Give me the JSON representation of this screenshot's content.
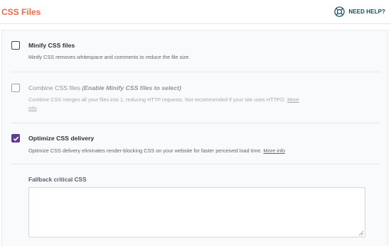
{
  "header": {
    "title": "CSS Files",
    "help_label": "NEED HELP?",
    "help_icon": "lifebuoy-icon"
  },
  "options": [
    {
      "label": "Minify CSS files",
      "note": "",
      "description": "Minify CSS removes whitespace and comments to reduce the file size.",
      "link": "",
      "checked": false,
      "disabled": false
    },
    {
      "label": "Combine CSS files",
      "note": "(Enable Minify CSS files to select)",
      "description": "Combine CSS merges all your files into 1, reducing HTTP requests. Not recommended if your site uses HTTP/2.",
      "link_part1": "More",
      "link_part2": "info",
      "checked": false,
      "disabled": true
    },
    {
      "label": "Optimize CSS delivery",
      "note": "",
      "description": "Optimize CSS delivery eliminates render-blocking CSS on your website for faster perceived load time.",
      "link": "More info",
      "checked": true,
      "disabled": false
    }
  ],
  "fallback": {
    "label": "Fallback critical CSS",
    "value": ""
  },
  "colors": {
    "title": "#f56640",
    "help": "#0e4d6b",
    "checkbox_checked": "#5f3c8e"
  }
}
